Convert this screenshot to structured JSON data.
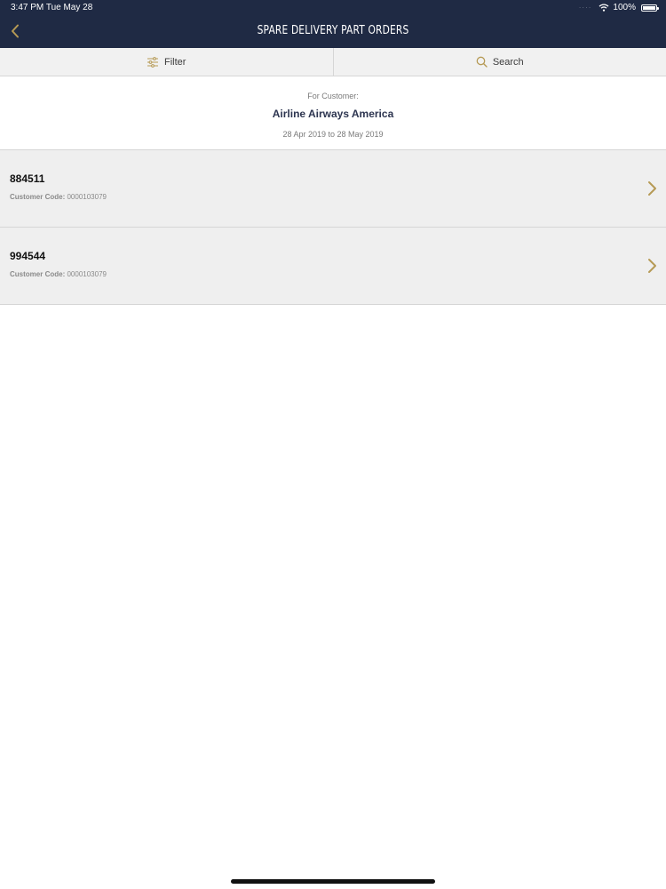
{
  "status_bar": {
    "time_date": "3:47 PM   Tue May 28",
    "battery": "100%"
  },
  "nav": {
    "title": "SPARE DELIVERY PART ORDERS",
    "back_icon": "chevron-left-icon"
  },
  "toolbar": {
    "filter_label": "Filter",
    "search_label": "Search",
    "filter_icon": "sliders-icon",
    "search_icon": "search-icon"
  },
  "customer": {
    "label": "For Customer:",
    "name": "Airline Airways America",
    "date_range": "28 Apr 2019 to 28 May 2019"
  },
  "orders": [
    {
      "id": "884511",
      "code_label": "Customer Code:",
      "code": "0000103079"
    },
    {
      "id": "994544",
      "code_label": "Customer Code:",
      "code": "0000103079"
    }
  ],
  "colors": {
    "header_bg": "#1f2a44",
    "accent_gold": "#b69a55",
    "row_bg": "#efefef"
  }
}
